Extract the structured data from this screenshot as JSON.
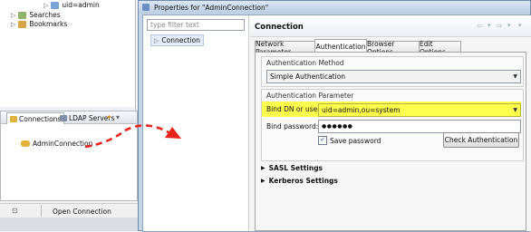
{
  "explorer": {
    "uid_item": "uid=admin",
    "searches": "Searches",
    "bookmarks": "Bookmarks"
  },
  "connections_view": {
    "tabs": [
      "Connections",
      "LDAP Servers"
    ],
    "connection_item": "AdminConnection",
    "open_connection": "Open Connection"
  },
  "dialog": {
    "title": "Properties for \"AdminConnection\"",
    "filter_placeholder": "type filter text",
    "tree_item": "Connection",
    "page_title": "Connection",
    "tabs": [
      "Network Parameter",
      "Authentication",
      "Browser Options",
      "Edit Options"
    ],
    "auth_method_group": "Authentication Method",
    "auth_method_value": "Simple Authentication",
    "auth_param_group": "Authentication Parameter",
    "bind_dn_label": "Bind DN or user:",
    "bind_dn_value": "uid=admin,ou=system",
    "bind_pw_label": "Bind password:",
    "bind_pw_value": "●●●●●●",
    "save_password": "Save password",
    "check_auth": "Check Authentication",
    "sasl": "SASL Settings",
    "kerberos": "Kerberos Settings"
  },
  "colors": {
    "highlight": "#ffff4d",
    "arrow": "#e8231b"
  }
}
